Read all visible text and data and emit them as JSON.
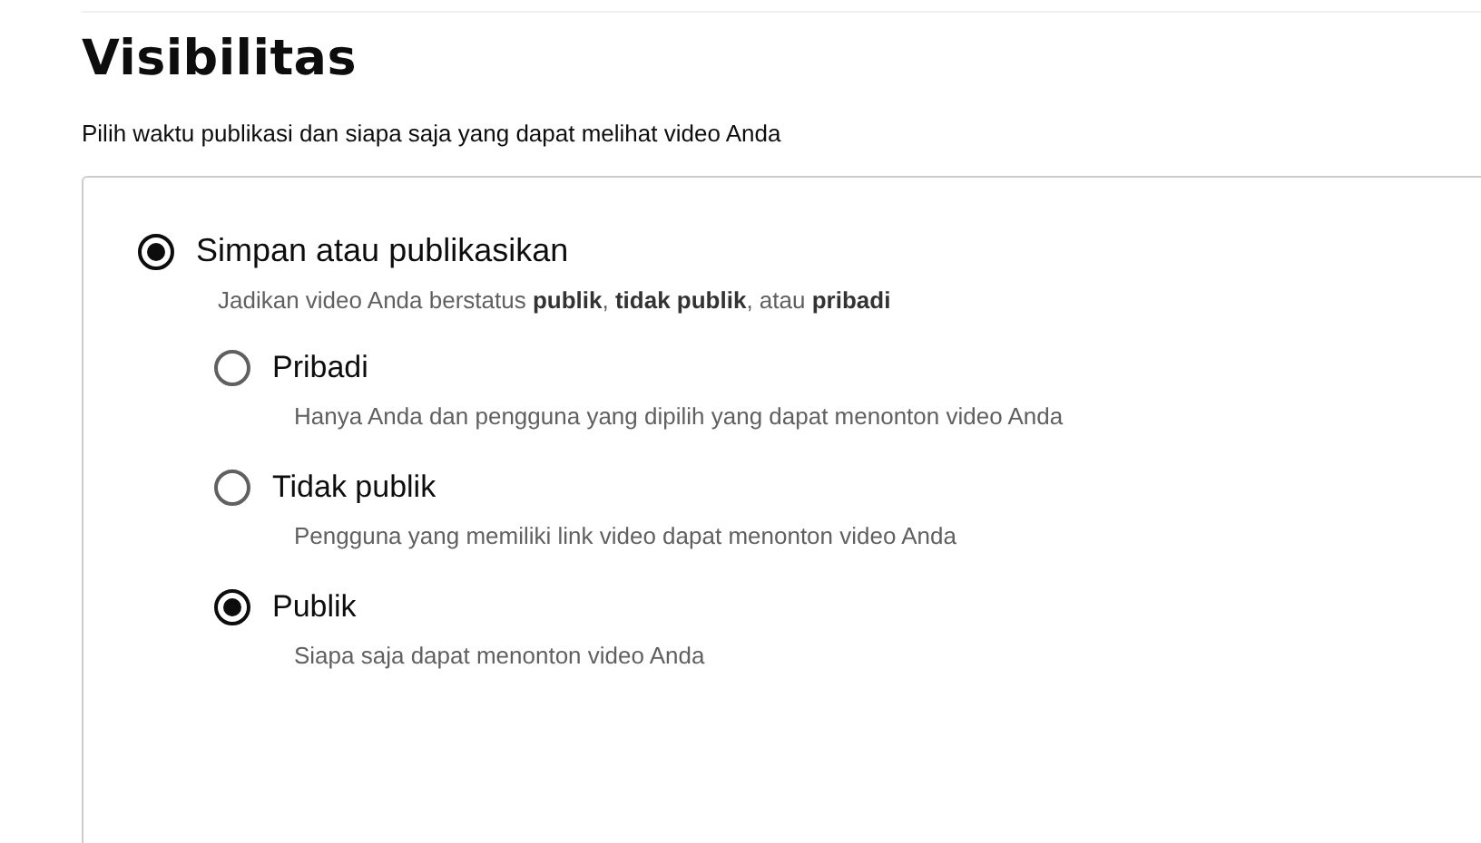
{
  "title": "Visibilitas",
  "subtitle": "Pilih waktu publikasi dan siapa saja yang dapat melihat video Anda",
  "options": [
    {
      "label": "Simpan atau publikasikan",
      "description": "Jadikan video Anda berstatus **publik**, **tidak publik**, atau **pribadi**",
      "selected": true,
      "children": [
        {
          "label": "Pribadi",
          "description": "Hanya Anda dan pengguna yang dipilih yang dapat menonton video Anda",
          "selected": false
        },
        {
          "label": "Tidak publik",
          "description": "Pengguna yang memiliki link video dapat menonton video Anda",
          "selected": false
        },
        {
          "label": "Publik",
          "description": "Siapa saja dapat menonton video Anda",
          "selected": true
        }
      ]
    }
  ]
}
